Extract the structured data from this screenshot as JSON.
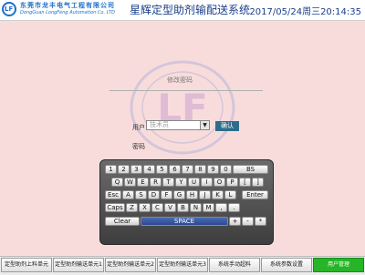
{
  "header": {
    "logo_text": "LF",
    "company_cn": "东莞市龙丰电气工程有限公司",
    "company_en": "DongGuan LongFeng Automation Co. LTD",
    "title": "星辉定型助剂输配送系统",
    "datetime": "2017/05/24周三20:14:35"
  },
  "watermark_text": "LF",
  "login": {
    "title": "修改密码",
    "user_label": "用户",
    "user_value": "技术员",
    "login_button": "确认",
    "password_label": "密码"
  },
  "keyboard": {
    "rows": [
      [
        "1",
        "2",
        "3",
        "4",
        "5",
        "6",
        "7",
        "8",
        "9",
        "0",
        "BS"
      ],
      [
        "Q",
        "W",
        "E",
        "R",
        "T",
        "Y",
        "U",
        "I",
        "O",
        "P",
        "[",
        "]"
      ],
      [
        "Esc",
        "A",
        "S",
        "D",
        "F",
        "G",
        "H",
        "J",
        "K",
        "L",
        "Enter"
      ],
      [
        "Caps",
        "Z",
        "X",
        "C",
        "V",
        "B",
        "N",
        "M",
        ",",
        "."
      ],
      [
        "Clear",
        "SPACE",
        "+",
        "-",
        "*"
      ]
    ]
  },
  "nav": [
    {
      "label": "定型助剂上料单元",
      "active": false
    },
    {
      "label": "定型助剂输送单元1",
      "active": false
    },
    {
      "label": "定型助剂输送单元2",
      "active": false
    },
    {
      "label": "定型助剂输送单元3",
      "active": false
    },
    {
      "label": "系统手动超料",
      "active": false
    },
    {
      "label": "系统参数设置",
      "active": false
    },
    {
      "label": "用户管理",
      "active": true
    }
  ]
}
